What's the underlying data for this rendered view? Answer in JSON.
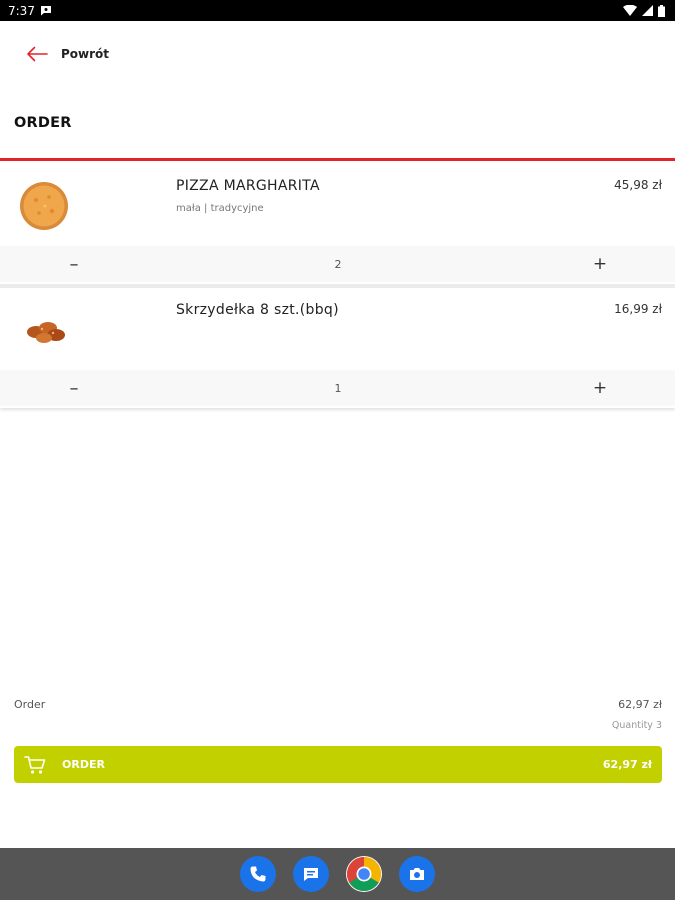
{
  "status_bar": {
    "time": "7:37"
  },
  "header": {
    "back_label": "Powrót"
  },
  "page": {
    "title": "ORDER"
  },
  "items": [
    {
      "name": "PIZZA MARGHARITA",
      "description": "mała | tradycyjne",
      "price": "45,98 zł",
      "quantity": "2",
      "image_icon": "pizza-image"
    },
    {
      "name": "Skrzydełka 8 szt.(bbq)",
      "description": "",
      "price": "16,99 zł",
      "quantity": "1",
      "image_icon": "chicken-wings-image"
    }
  ],
  "summary": {
    "label": "Order",
    "total": "62,97 zł",
    "quantity_text": "Quantity 3"
  },
  "order_button": {
    "label": "ORDER",
    "total": "62,97 zł"
  },
  "colors": {
    "accent_red": "#e1252a",
    "order_button": "#c2d000",
    "nav_bar": "#555555"
  },
  "dock": [
    "phone-icon",
    "messages-icon",
    "chrome-icon",
    "camera-icon"
  ]
}
